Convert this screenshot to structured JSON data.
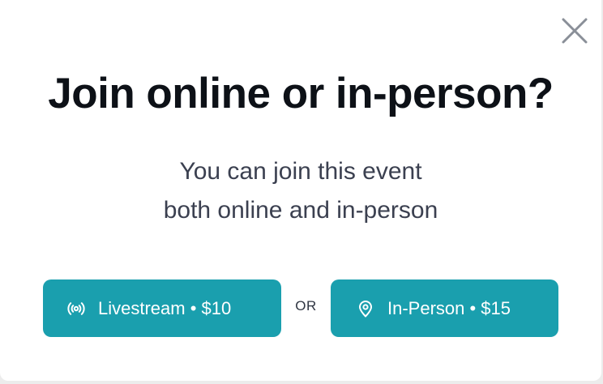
{
  "dialog": {
    "title": "Join online or in-person?",
    "subtitle_line1": "You can join this event",
    "subtitle_line2": "both online and in-person",
    "close_icon": "close-icon"
  },
  "options": {
    "livestream": {
      "label": "Livestream • $10",
      "icon": "broadcast-icon"
    },
    "separator": "OR",
    "in_person": {
      "label": "In-Person • $15",
      "icon": "location-pin-icon"
    }
  },
  "colors": {
    "accent": "#1a9fae",
    "title": "#0d1117",
    "subtitle": "#3b4050",
    "close": "#8a8f98"
  }
}
